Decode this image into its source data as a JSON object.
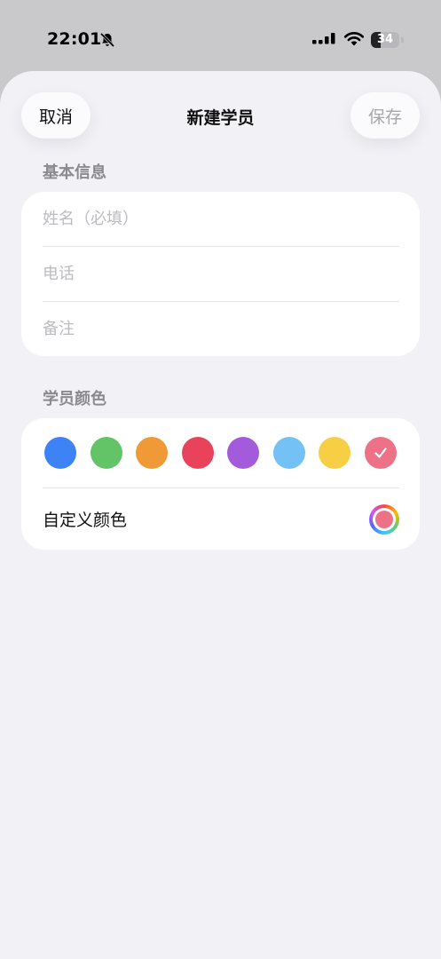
{
  "status": {
    "time": "22:01",
    "battery_text": "34",
    "battery_level": 0.34
  },
  "nav": {
    "cancel": "取消",
    "title": "新建学员",
    "save": "保存"
  },
  "basic": {
    "section_title": "基本信息",
    "name_placeholder": "姓名（必填）",
    "phone_placeholder": "电话",
    "note_placeholder": "备注"
  },
  "color": {
    "section_title": "学员颜色",
    "swatches": [
      "#3d83f5",
      "#62c466",
      "#f09a37",
      "#e8435a",
      "#a45bdb",
      "#73c1f5",
      "#f7cf45",
      "#ee7287"
    ],
    "selected_index": 7,
    "custom_label": "自定义颜色",
    "custom_color": "#ee7287"
  }
}
